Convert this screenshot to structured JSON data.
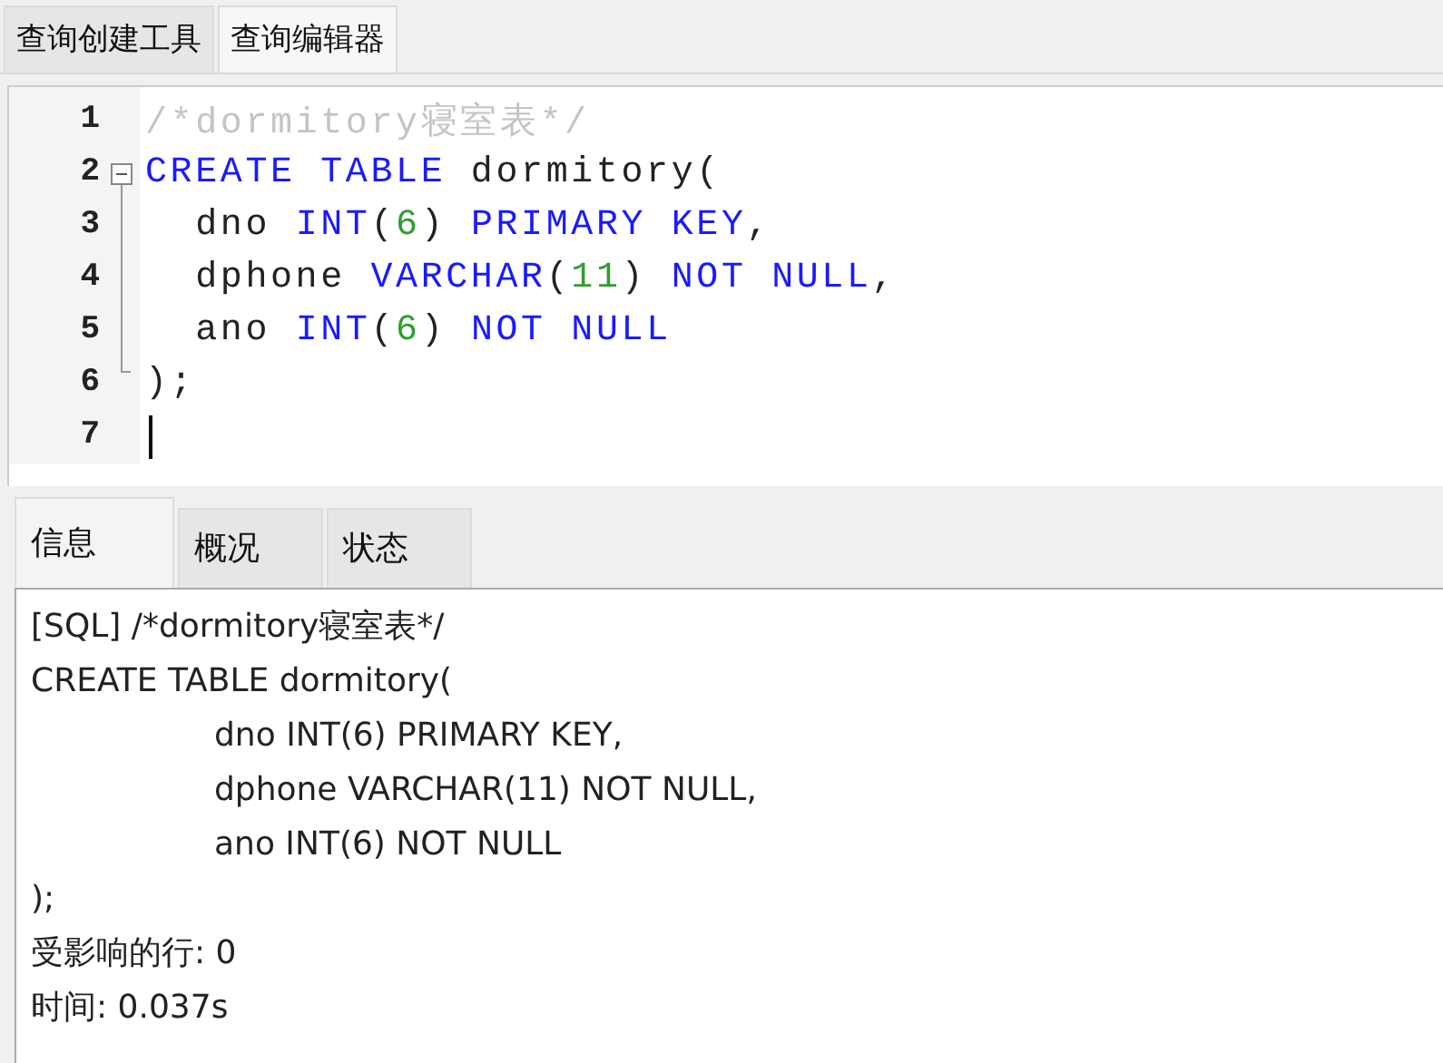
{
  "top_tabs": [
    {
      "label": "查询创建工具",
      "selected": false
    },
    {
      "label": "查询编辑器",
      "selected": true
    }
  ],
  "editor": {
    "lines": [
      {
        "number": "1",
        "tokens": [
          {
            "kind": "comment",
            "text": "/*dormitory寝室表*/"
          }
        ]
      },
      {
        "number": "2",
        "collapsible": true,
        "tokens": [
          {
            "kind": "keyword",
            "text": "CREATE TABLE"
          },
          {
            "kind": "plain",
            "text": " dormitory("
          }
        ]
      },
      {
        "number": "3",
        "tokens": [
          {
            "kind": "plain",
            "text": "  dno "
          },
          {
            "kind": "keyword",
            "text": "INT"
          },
          {
            "kind": "plain",
            "text": "("
          },
          {
            "kind": "number",
            "text": "6"
          },
          {
            "kind": "plain",
            "text": ") "
          },
          {
            "kind": "keyword",
            "text": "PRIMARY KEY"
          },
          {
            "kind": "plain",
            "text": ","
          }
        ]
      },
      {
        "number": "4",
        "tokens": [
          {
            "kind": "plain",
            "text": "  dphone "
          },
          {
            "kind": "keyword",
            "text": "VARCHAR"
          },
          {
            "kind": "plain",
            "text": "("
          },
          {
            "kind": "number",
            "text": "11"
          },
          {
            "kind": "plain",
            "text": ") "
          },
          {
            "kind": "keyword",
            "text": "NOT NULL"
          },
          {
            "kind": "plain",
            "text": ","
          }
        ]
      },
      {
        "number": "5",
        "tokens": [
          {
            "kind": "plain",
            "text": "  ano "
          },
          {
            "kind": "keyword",
            "text": "INT"
          },
          {
            "kind": "plain",
            "text": "("
          },
          {
            "kind": "number",
            "text": "6"
          },
          {
            "kind": "plain",
            "text": ") "
          },
          {
            "kind": "keyword",
            "text": "NOT NULL"
          }
        ]
      },
      {
        "number": "6",
        "tokens": [
          {
            "kind": "plain",
            "text": ");"
          }
        ]
      },
      {
        "number": "7",
        "cursor": true
      }
    ]
  },
  "bottom_tabs": [
    {
      "label": "信息",
      "selected": true
    },
    {
      "label": "概况",
      "selected": false
    },
    {
      "label": "状态",
      "selected": false
    }
  ],
  "output": {
    "lines": [
      {
        "text": "[SQL] /*dormitory寝室表*/"
      },
      {
        "text": "CREATE TABLE dormitory(",
        "children": [
          {
            "text": "dno INT(6) PRIMARY KEY,"
          },
          {
            "text": "dphone VARCHAR(11) NOT NULL,"
          },
          {
            "text": "ano INT(6) NOT NULL"
          }
        ]
      },
      {
        "text": ");"
      },
      {
        "text": "受影响的行: 0"
      },
      {
        "text": "时间: 0.037s"
      }
    ]
  }
}
